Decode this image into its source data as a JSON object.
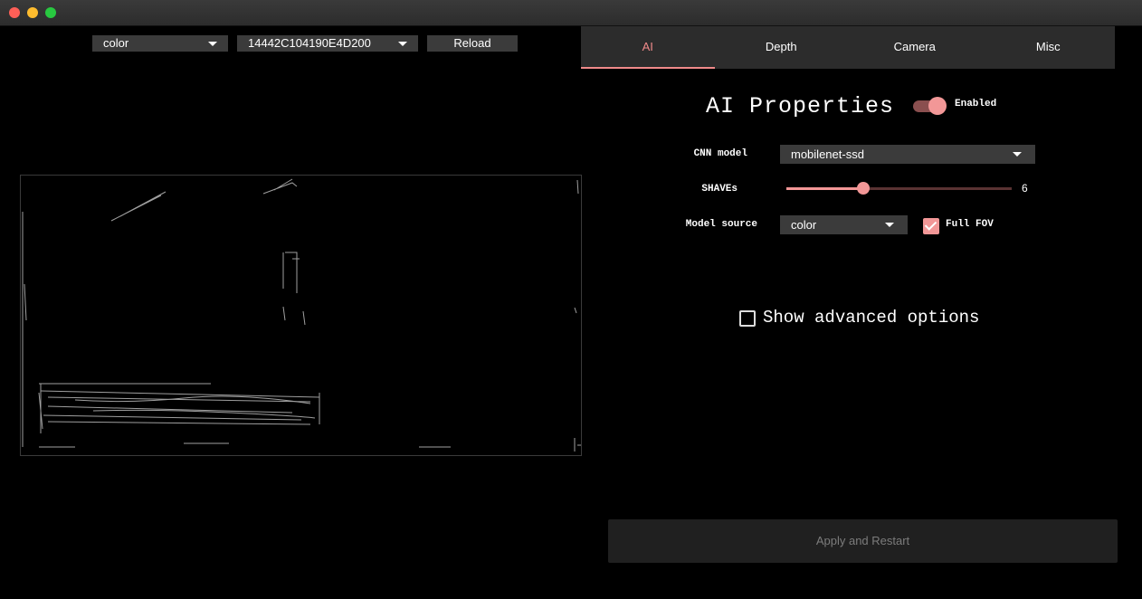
{
  "window": {
    "controls": [
      "close",
      "minimize",
      "maximize"
    ]
  },
  "toolbar": {
    "source_select": "color",
    "device_select": "14442C104190E4D200",
    "reload_label": "Reload"
  },
  "tabs": [
    {
      "label": "AI",
      "active": true
    },
    {
      "label": "Depth",
      "active": false
    },
    {
      "label": "Camera",
      "active": false
    },
    {
      "label": "Misc",
      "active": false
    }
  ],
  "ai": {
    "title": "AI Properties",
    "enabled_label": "Enabled",
    "enabled": true,
    "cnn_model_label": "CNN model",
    "cnn_model_value": "mobilenet-ssd",
    "shaves_label": "SHAVEs",
    "shaves_value": "6",
    "shaves_fraction": 0.34,
    "model_source_label": "Model source",
    "model_source_value": "color",
    "full_fov_label": "Full FOV",
    "full_fov_checked": true,
    "advanced_label": "Show advanced options",
    "advanced_checked": false
  },
  "apply_label": "Apply and Restart",
  "colors": {
    "accent": "#f29797",
    "panel": "#2c2c2c",
    "control": "#3b3b3b"
  }
}
